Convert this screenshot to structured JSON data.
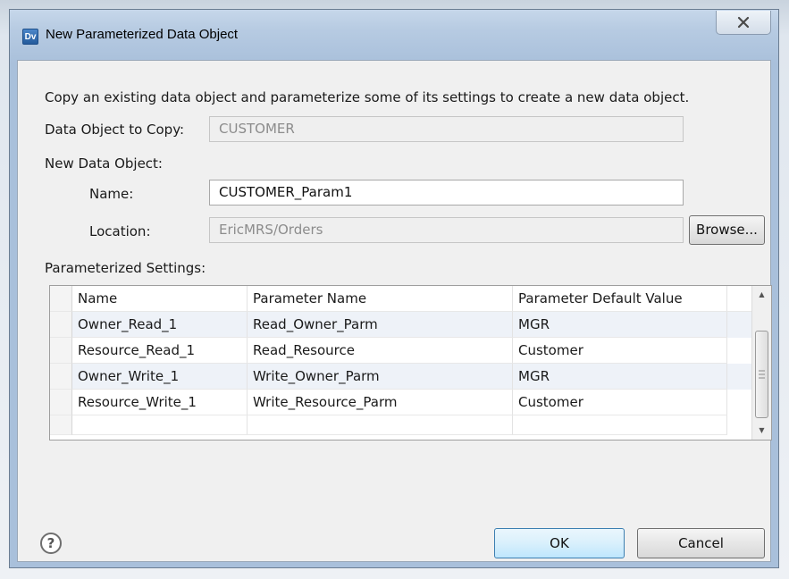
{
  "window": {
    "title": "New Parameterized Data Object",
    "app_icon_text": "Dv",
    "close_icon": "close-icon"
  },
  "form": {
    "description": "Copy an existing data object and parameterize some of its settings to create a new data object.",
    "copy_label": "Data Object to Copy:",
    "copy_value": "CUSTOMER",
    "new_object_label": "New Data Object:",
    "name_label": "Name:",
    "name_value": "CUSTOMER_Param1",
    "location_label": "Location:",
    "location_value": "EricMRS/Orders",
    "browse_label": "Browse...",
    "settings_label": "Parameterized Settings:"
  },
  "table": {
    "columns": [
      "Name",
      "Parameter Name",
      "Parameter Default Value"
    ],
    "rows": [
      [
        "Owner_Read_1",
        "Read_Owner_Parm",
        "MGR"
      ],
      [
        "Resource_Read_1",
        "Read_Resource",
        "Customer"
      ],
      [
        "Owner_Write_1",
        "Write_Owner_Parm",
        "MGR"
      ],
      [
        "Resource_Write_1",
        "Write_Resource_Parm",
        "Customer"
      ]
    ]
  },
  "footer": {
    "help_icon": "help-icon",
    "help_glyph": "?",
    "ok_label": "OK",
    "cancel_label": "Cancel"
  }
}
